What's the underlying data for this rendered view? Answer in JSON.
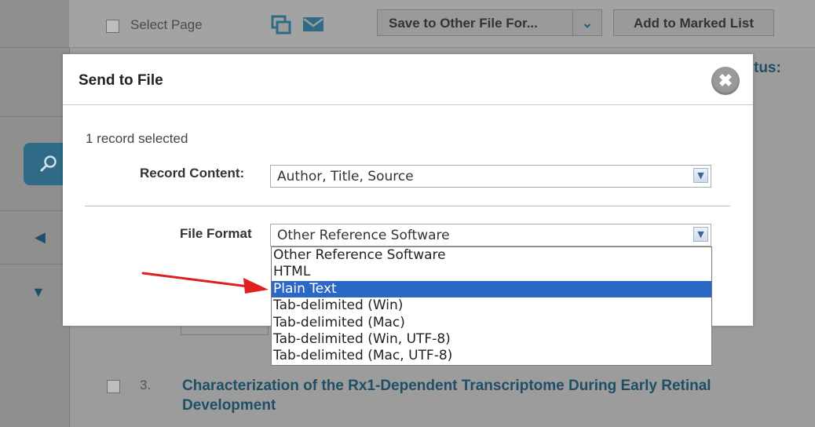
{
  "background_page": {
    "select_page_label": "Select Page",
    "save_button_label": "Save to Other File For...",
    "add_marked_list_label": "Add to Marked List",
    "partial_heading_text": "tus:",
    "result": {
      "number": "3.",
      "title": "Characterization of the Rx1-Dependent Transcriptome During Early Retinal Development"
    }
  },
  "modal": {
    "title": "Send to File",
    "records_selected": "1 record selected",
    "record_content": {
      "label": "Record Content:",
      "value": "Author, Title, Source"
    },
    "file_format": {
      "label": "File Format",
      "value": "Other Reference Software",
      "options": [
        "Other Reference Software",
        "HTML",
        "Plain Text",
        "Tab-delimited (Win)",
        "Tab-delimited (Mac)",
        "Tab-delimited (Win, UTF-8)",
        "Tab-delimited (Mac, UTF-8)"
      ],
      "highlighted_option": "Plain Text"
    }
  },
  "colors": {
    "highlight": "#2b67c5",
    "link_blue": "#1f4f66",
    "annotation_arrow": "#e02020"
  }
}
